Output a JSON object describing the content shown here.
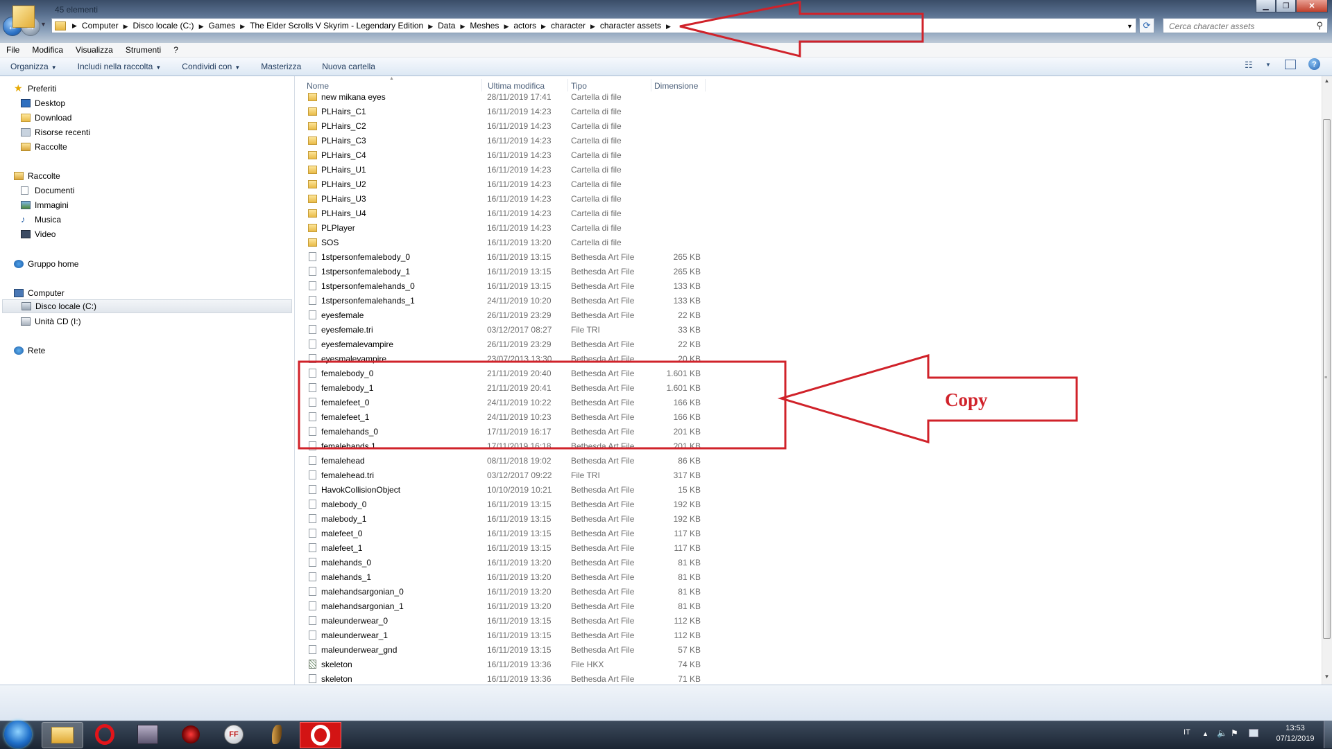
{
  "address": {
    "crumbs": [
      "Computer",
      "Disco locale (C:)",
      "Games",
      "The Elder Scrolls V Skyrim - Legendary Edition",
      "Data",
      "Meshes",
      "actors",
      "character",
      "character assets"
    ],
    "search_placeholder": "Cerca character assets"
  },
  "menu": [
    "File",
    "Modifica",
    "Visualizza",
    "Strumenti",
    "?"
  ],
  "toolbar": [
    "Organizza",
    "Includi nella raccolta",
    "Condividi con",
    "Masterizza",
    "Nuova cartella"
  ],
  "nav": {
    "favorites_title": "Preferiti",
    "favorites": [
      "Desktop",
      "Download",
      "Risorse recenti",
      "Raccolte"
    ],
    "libraries_title": "Raccolte",
    "libraries": [
      "Documenti",
      "Immagini",
      "Musica",
      "Video"
    ],
    "homegroup": "Gruppo home",
    "computer_title": "Computer",
    "computer": [
      "Disco locale (C:)",
      "Unità CD (I:)"
    ],
    "network": "Rete"
  },
  "columns": [
    "Nome",
    "Ultima modifica",
    "Tipo",
    "Dimensione"
  ],
  "files": [
    {
      "name": "new mikana eyes",
      "date": "28/11/2019 17:41",
      "type": "Cartella di file",
      "size": "",
      "kind": "folder"
    },
    {
      "name": "PLHairs_C1",
      "date": "16/11/2019 14:23",
      "type": "Cartella di file",
      "size": "",
      "kind": "folder"
    },
    {
      "name": "PLHairs_C2",
      "date": "16/11/2019 14:23",
      "type": "Cartella di file",
      "size": "",
      "kind": "folder"
    },
    {
      "name": "PLHairs_C3",
      "date": "16/11/2019 14:23",
      "type": "Cartella di file",
      "size": "",
      "kind": "folder"
    },
    {
      "name": "PLHairs_C4",
      "date": "16/11/2019 14:23",
      "type": "Cartella di file",
      "size": "",
      "kind": "folder"
    },
    {
      "name": "PLHairs_U1",
      "date": "16/11/2019 14:23",
      "type": "Cartella di file",
      "size": "",
      "kind": "folder"
    },
    {
      "name": "PLHairs_U2",
      "date": "16/11/2019 14:23",
      "type": "Cartella di file",
      "size": "",
      "kind": "folder"
    },
    {
      "name": "PLHairs_U3",
      "date": "16/11/2019 14:23",
      "type": "Cartella di file",
      "size": "",
      "kind": "folder"
    },
    {
      "name": "PLHairs_U4",
      "date": "16/11/2019 14:23",
      "type": "Cartella di file",
      "size": "",
      "kind": "folder"
    },
    {
      "name": "PLPlayer",
      "date": "16/11/2019 14:23",
      "type": "Cartella di file",
      "size": "",
      "kind": "folder"
    },
    {
      "name": "SOS",
      "date": "16/11/2019 13:20",
      "type": "Cartella di file",
      "size": "",
      "kind": "folder"
    },
    {
      "name": "1stpersonfemalebody_0",
      "date": "16/11/2019 13:15",
      "type": "Bethesda Art File",
      "size": "265 KB",
      "kind": "file"
    },
    {
      "name": "1stpersonfemalebody_1",
      "date": "16/11/2019 13:15",
      "type": "Bethesda Art File",
      "size": "265 KB",
      "kind": "file"
    },
    {
      "name": "1stpersonfemalehands_0",
      "date": "16/11/2019 13:15",
      "type": "Bethesda Art File",
      "size": "133 KB",
      "kind": "file"
    },
    {
      "name": "1stpersonfemalehands_1",
      "date": "24/11/2019 10:20",
      "type": "Bethesda Art File",
      "size": "133 KB",
      "kind": "file"
    },
    {
      "name": "eyesfemale",
      "date": "26/11/2019 23:29",
      "type": "Bethesda Art File",
      "size": "22 KB",
      "kind": "file"
    },
    {
      "name": "eyesfemale.tri",
      "date": "03/12/2017 08:27",
      "type": "File TRI",
      "size": "33 KB",
      "kind": "file"
    },
    {
      "name": "eyesfemalevampire",
      "date": "26/11/2019 23:29",
      "type": "Bethesda Art File",
      "size": "22 KB",
      "kind": "file"
    },
    {
      "name": "eyesmalevampire",
      "date": "23/07/2013 13:30",
      "type": "Bethesda Art File",
      "size": "20 KB",
      "kind": "file"
    },
    {
      "name": "femalebody_0",
      "date": "21/11/2019 20:40",
      "type": "Bethesda Art File",
      "size": "1.601 KB",
      "kind": "file"
    },
    {
      "name": "femalebody_1",
      "date": "21/11/2019 20:41",
      "type": "Bethesda Art File",
      "size": "1.601 KB",
      "kind": "file"
    },
    {
      "name": "femalefeet_0",
      "date": "24/11/2019 10:22",
      "type": "Bethesda Art File",
      "size": "166 KB",
      "kind": "file"
    },
    {
      "name": "femalefeet_1",
      "date": "24/11/2019 10:23",
      "type": "Bethesda Art File",
      "size": "166 KB",
      "kind": "file"
    },
    {
      "name": "femalehands_0",
      "date": "17/11/2019 16:17",
      "type": "Bethesda Art File",
      "size": "201 KB",
      "kind": "file"
    },
    {
      "name": "femalehands 1",
      "date": "17/11/2019 16:18",
      "type": "Bethesda Art File",
      "size": "201 KB",
      "kind": "file"
    },
    {
      "name": "femalehead",
      "date": "08/11/2018 19:02",
      "type": "Bethesda Art File",
      "size": "86 KB",
      "kind": "file"
    },
    {
      "name": "femalehead.tri",
      "date": "03/12/2017 09:22",
      "type": "File TRI",
      "size": "317 KB",
      "kind": "file"
    },
    {
      "name": "HavokCollisionObject",
      "date": "10/10/2019 10:21",
      "type": "Bethesda Art File",
      "size": "15 KB",
      "kind": "file"
    },
    {
      "name": "malebody_0",
      "date": "16/11/2019 13:15",
      "type": "Bethesda Art File",
      "size": "192 KB",
      "kind": "file"
    },
    {
      "name": "malebody_1",
      "date": "16/11/2019 13:15",
      "type": "Bethesda Art File",
      "size": "192 KB",
      "kind": "file"
    },
    {
      "name": "malefeet_0",
      "date": "16/11/2019 13:15",
      "type": "Bethesda Art File",
      "size": "117 KB",
      "kind": "file"
    },
    {
      "name": "malefeet_1",
      "date": "16/11/2019 13:15",
      "type": "Bethesda Art File",
      "size": "117 KB",
      "kind": "file"
    },
    {
      "name": "malehands_0",
      "date": "16/11/2019 13:20",
      "type": "Bethesda Art File",
      "size": "81 KB",
      "kind": "file"
    },
    {
      "name": "malehands_1",
      "date": "16/11/2019 13:20",
      "type": "Bethesda Art File",
      "size": "81 KB",
      "kind": "file"
    },
    {
      "name": "malehandsargonian_0",
      "date": "16/11/2019 13:20",
      "type": "Bethesda Art File",
      "size": "81 KB",
      "kind": "file"
    },
    {
      "name": "malehandsargonian_1",
      "date": "16/11/2019 13:20",
      "type": "Bethesda Art File",
      "size": "81 KB",
      "kind": "file"
    },
    {
      "name": "maleunderwear_0",
      "date": "16/11/2019 13:15",
      "type": "Bethesda Art File",
      "size": "112 KB",
      "kind": "file"
    },
    {
      "name": "maleunderwear_1",
      "date": "16/11/2019 13:15",
      "type": "Bethesda Art File",
      "size": "112 KB",
      "kind": "file"
    },
    {
      "name": "maleunderwear_gnd",
      "date": "16/11/2019 13:15",
      "type": "Bethesda Art File",
      "size": "57 KB",
      "kind": "file"
    },
    {
      "name": "skeleton",
      "date": "16/11/2019 13:36",
      "type": "File HKX",
      "size": "74 KB",
      "kind": "hkx"
    },
    {
      "name": "skeleton",
      "date": "16/11/2019 13:36",
      "type": "Bethesda Art File",
      "size": "71 KB",
      "kind": "file"
    }
  ],
  "status": {
    "count": "45 elementi"
  },
  "annotation": {
    "label": "Copy",
    "color": "#d0222a"
  },
  "tray": {
    "lang": "IT",
    "time": "13:53",
    "date": "07/12/2019"
  }
}
